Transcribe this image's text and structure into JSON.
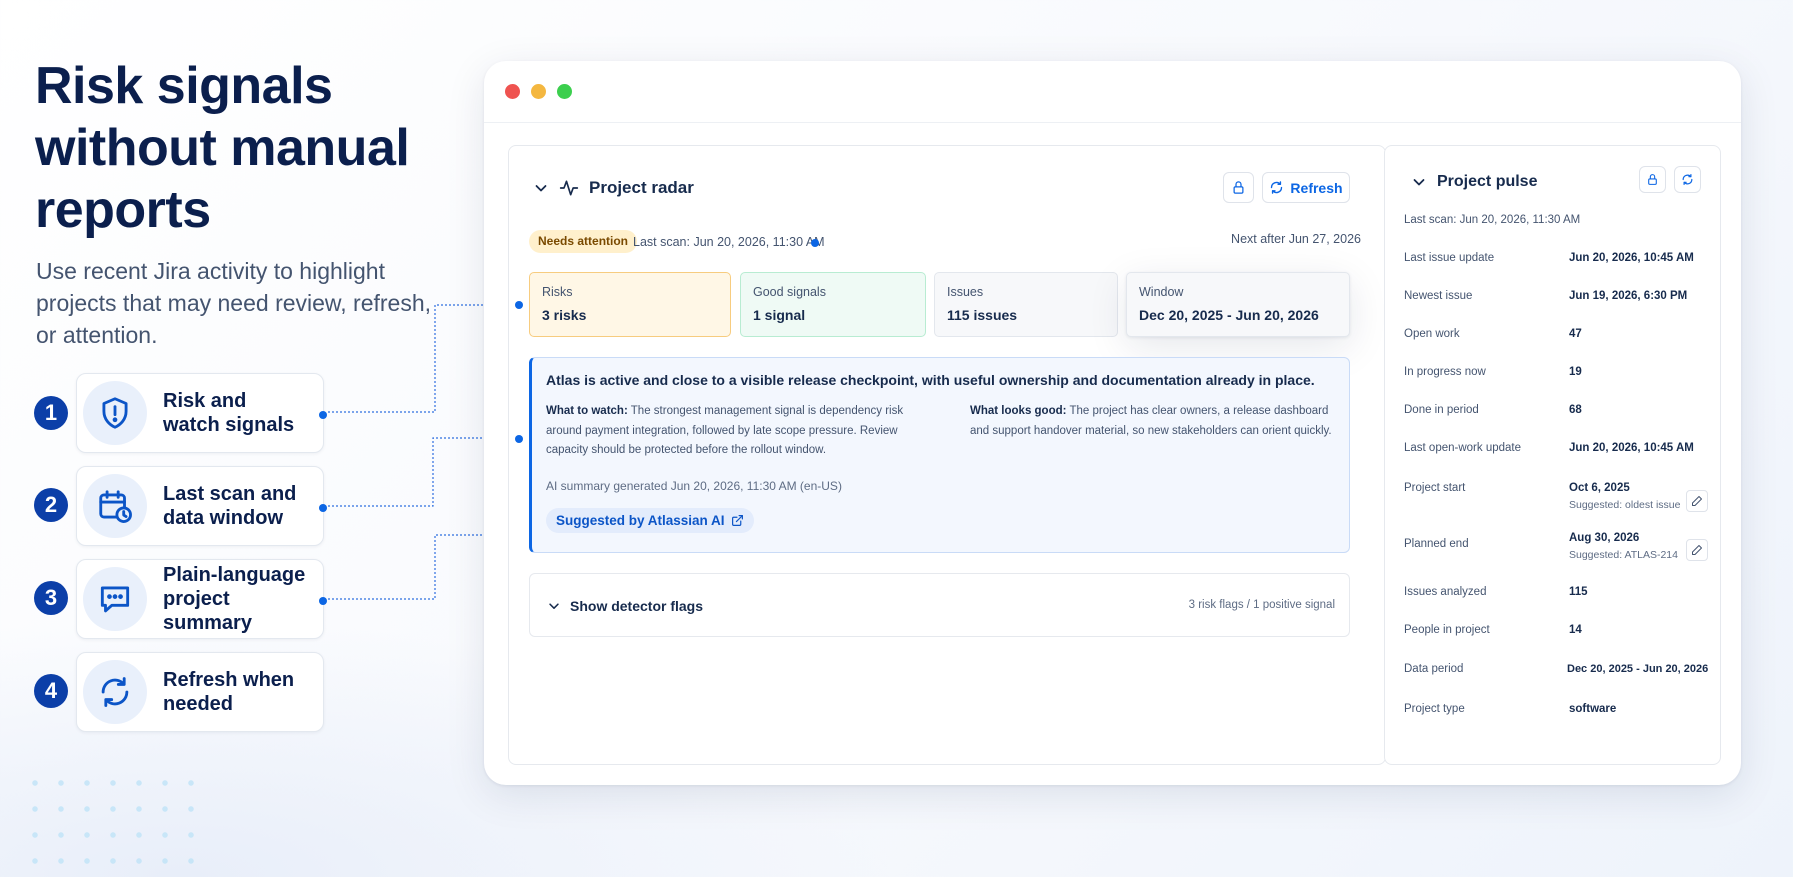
{
  "hero": {
    "title": "Risk signals without manual reports",
    "subtitle": "Use recent Jira activity to highlight projects that may need review, refresh, or attention."
  },
  "features": [
    {
      "number": "1",
      "label_line1": "Risk and",
      "label_line2": "watch signals",
      "icon": "shield-alert-icon"
    },
    {
      "number": "2",
      "label_line1": "Last scan and",
      "label_line2": "data window",
      "icon": "calendar-clock-icon"
    },
    {
      "number": "3",
      "label_line1": "Plain-language",
      "label_line2": "project summary",
      "icon": "chat-bubble-icon"
    },
    {
      "number": "4",
      "label_line1": "Refresh when",
      "label_line2": "needed",
      "icon": "refresh-icon"
    }
  ],
  "radar": {
    "title": "Project radar",
    "refresh_label": "Refresh",
    "status_badge": "Needs attention",
    "last_scan": "Last scan: Jun 20, 2026, 11:30 AM",
    "next_after": "Next after Jun 27, 2026",
    "stats": [
      {
        "label": "Risks",
        "value": "3 risks"
      },
      {
        "label": "Good signals",
        "value": "1 signal"
      },
      {
        "label": "Issues",
        "value": "115 issues"
      },
      {
        "label": "Window",
        "value": "Dec 20, 2025 - Jun 20, 2026"
      }
    ],
    "summary": {
      "title": "Atlas is active and close to a visible release checkpoint, with useful ownership and documentation already in place.",
      "watch_label": "What to watch:",
      "watch_text": "The strongest management signal is dependency risk around payment integration, followed by late scope pressure. Review capacity should be protected before the rollout window.",
      "good_label": "What looks good:",
      "good_text": "The project has clear owners, a release dashboard and support handover material, so new stakeholders can orient quickly.",
      "generated": "AI summary generated Jun 20, 2026, 11:30 AM (en-US)",
      "ai_pill": "Suggested by Atlassian AI"
    },
    "flags": {
      "title": "Show detector flags",
      "count": "3 risk flags / 1 positive signal"
    }
  },
  "pulse": {
    "title": "Project pulse",
    "last_scan": "Last scan: Jun 20, 2026, 11:30 AM",
    "rows": [
      {
        "label": "Last issue update",
        "value": "Jun 20, 2026, 10:45 AM"
      },
      {
        "label": "Newest issue",
        "value": "Jun 19, 2026, 6:30 PM"
      },
      {
        "label": "Open work",
        "value": "47"
      },
      {
        "label": "In progress now",
        "value": "19"
      },
      {
        "label": "Done in period",
        "value": "68"
      },
      {
        "label": "Last open-work update",
        "value": "Jun 20, 2026, 10:45 AM"
      },
      {
        "label": "Project start",
        "value": "Oct 6, 2025",
        "suggestion": "Suggested: oldest issue"
      },
      {
        "label": "Planned end",
        "value": "Aug 30, 2026",
        "suggestion": "Suggested: ATLAS-214"
      },
      {
        "label": "Issues analyzed",
        "value": "115"
      },
      {
        "label": "People in project",
        "value": "14"
      },
      {
        "label": "Data period",
        "value": "Dec 20, 2025 - Jun 20, 2026"
      },
      {
        "label": "Project type",
        "value": "software"
      }
    ]
  },
  "colors": {
    "accent": "#0c66e4",
    "badge_bg": "#fff0cc",
    "risk_bg": "#fff7e6",
    "good_bg": "#effaf5",
    "summary_bg": "#f3f7fe",
    "number_bg": "#0c3fa8"
  }
}
